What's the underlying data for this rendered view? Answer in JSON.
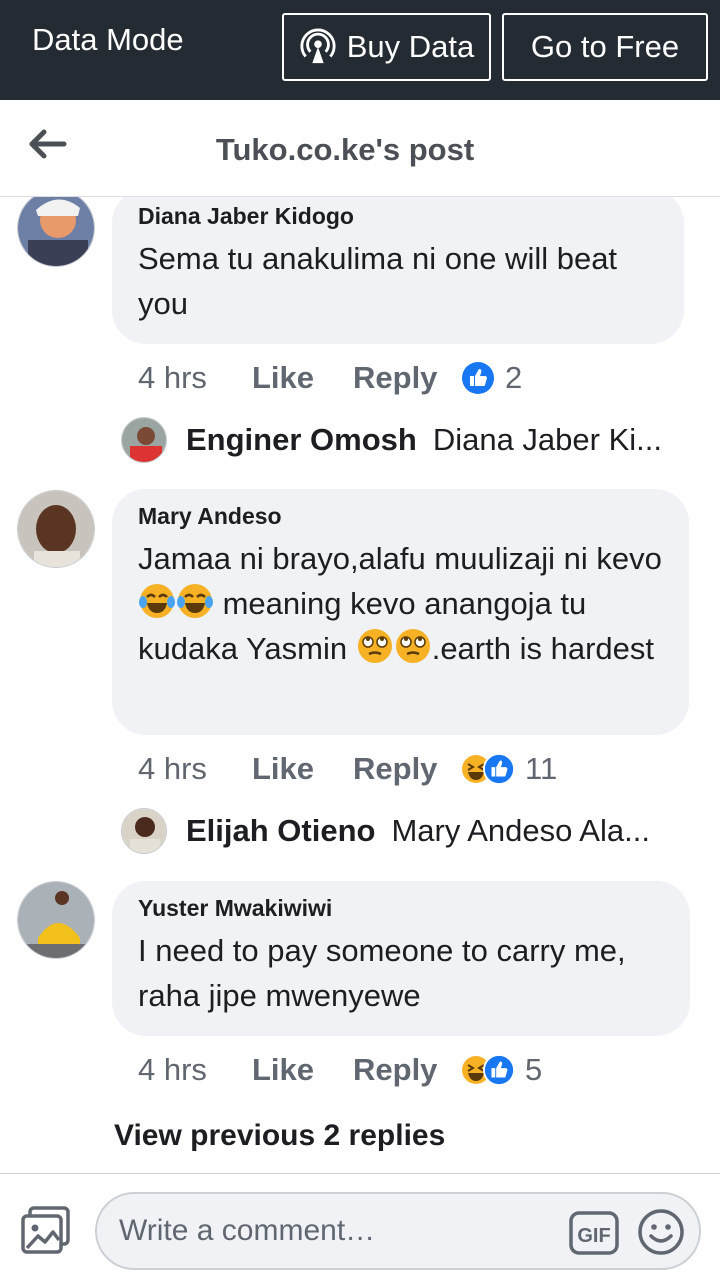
{
  "data_mode": {
    "label": "Data Mode",
    "buy_data": "Buy Data",
    "go_free": "Go to Free"
  },
  "header": {
    "title": "Tuko.co.ke's post"
  },
  "comments": [
    {
      "name": "Diana Jaber Kidogo",
      "text": "Sema tu anakulima ni one will beat you",
      "time": "4 hrs",
      "like": "Like",
      "reply": "Reply",
      "reaction_count": "2",
      "reply_preview": {
        "name": "Enginer Omosh",
        "text": "Diana Jaber Ki..."
      }
    },
    {
      "name": "Mary Andeso",
      "text_parts": [
        "Jamaa ni brayo,alafu muulizaji ni kevo",
        " meaning kevo anangoja tu kudaka Yasmin ",
        ".earth is hardest"
      ],
      "time": "4 hrs",
      "like": "Like",
      "reply": "Reply",
      "reaction_count": "11",
      "reply_preview": {
        "name": "Elijah Otieno",
        "text": "Mary Andeso Ala..."
      }
    },
    {
      "name": "Yuster Mwakiwiwi",
      "text": "I need to pay someone to carry me, raha jipe mwenyewe",
      "time": "4 hrs",
      "like": "Like",
      "reply": "Reply",
      "reaction_count": "5"
    }
  ],
  "view_previous": "View previous 2 replies",
  "composer": {
    "placeholder": "Write a comment…"
  },
  "colors": {
    "data_bar": "#252b33",
    "bubble": "#f0f2f5",
    "like_blue": "#1877f2",
    "haha_yellow": "#f7b125"
  }
}
